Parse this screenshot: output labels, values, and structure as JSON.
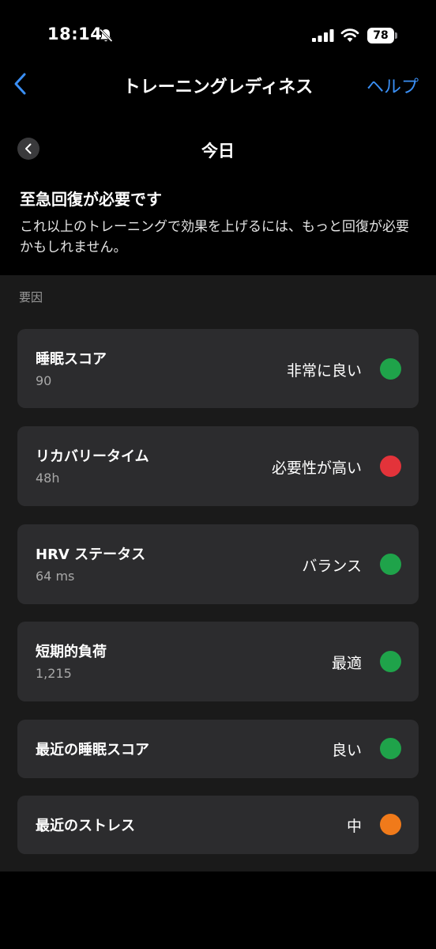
{
  "status_bar": {
    "time": "18:14",
    "battery": "78"
  },
  "nav": {
    "title": "トレーニングレディネス",
    "help": "ヘルプ"
  },
  "date": {
    "label": "今日"
  },
  "summary": {
    "headline": "至急回復が必要です",
    "description": "これ以上のトレーニングで効果を上げるには、もっと回復が必要かもしれません。"
  },
  "factors": {
    "section_label": "要因",
    "items": [
      {
        "title": "睡眠スコア",
        "value": "90",
        "status": "非常に良い",
        "color": "#1fa34a"
      },
      {
        "title": "リカバリータイム",
        "value": "48h",
        "status": "必要性が高い",
        "color": "#e3333a"
      },
      {
        "title": "HRV ステータス",
        "value": "64 ms",
        "status": "バランス",
        "color": "#1fa34a"
      },
      {
        "title": "短期的負荷",
        "value": "1,215",
        "status": "最適",
        "color": "#1fa34a"
      },
      {
        "title": "最近の睡眠スコア",
        "status": "良い",
        "color": "#1fa34a"
      },
      {
        "title": "最近のストレス",
        "status": "中",
        "color": "#f07a1a"
      }
    ]
  },
  "colors": {
    "accent": "#3a8ff5",
    "background": "#000000",
    "panel": "#1a1a1a",
    "card": "#2c2c2e"
  }
}
